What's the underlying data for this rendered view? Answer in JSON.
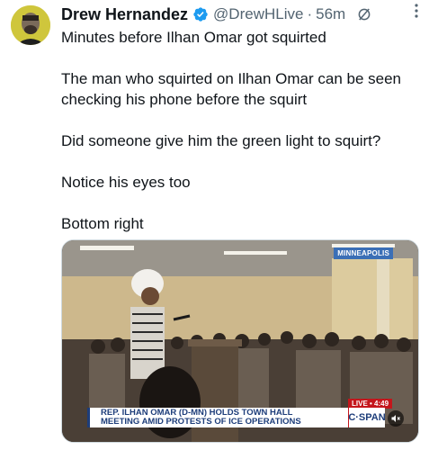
{
  "tweet": {
    "author_name": "Drew Hernandez",
    "handle": "@DrewHLive",
    "separator": "·",
    "time": "56m",
    "lines": [
      "Minutes before Ilhan Omar got squirted",
      "The man who squirted on Ilhan Omar can be seen checking his phone before the squirt",
      "Did someone give him the green light to squirt?",
      "Notice his eyes too",
      "Bottom right"
    ]
  },
  "media": {
    "network_bug": "MINNEAPOLIS",
    "live_label": "LIVE",
    "live_time": "4:49",
    "chyron_line1": "REP. ILHAN OMAR (D-MN) HOLDS TOWN HALL",
    "chyron_line2": "MEETING AMID PROTESTS OF ICE OPERATIONS",
    "network_logo": "C·SPAN"
  },
  "icons": {
    "verified": "verified-badge-icon",
    "grok": "grok-icon",
    "more": "more-options-icon",
    "mute": "mute-icon"
  },
  "colors": {
    "verified_blue": "#1d9bf0",
    "text": "#0f1419",
    "secondary": "#536471",
    "cspan_navy": "#1d3d7a",
    "live_red": "#c4161c"
  }
}
